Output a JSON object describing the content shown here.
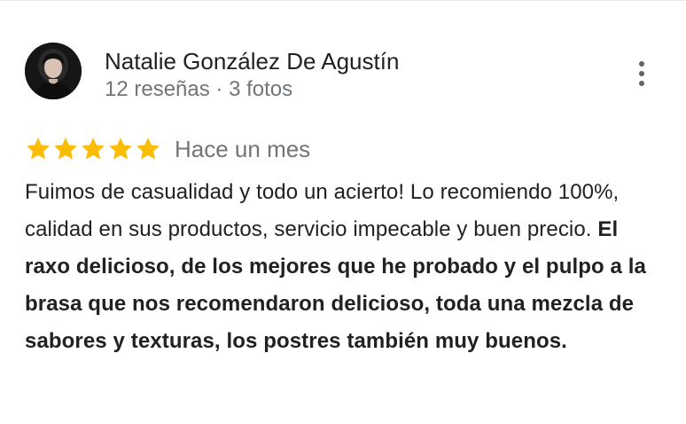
{
  "author": {
    "name": "Natalie González De Agustín",
    "meta": "12 reseñas · 3 fotos"
  },
  "review": {
    "rating": 5,
    "max_rating": 5,
    "date": "Hace un mes",
    "text_regular": "Fuimos de casualidad y todo un acierto! Lo recomiendo 100%, calidad en sus productos, servicio impecable y buen precio. ",
    "text_bold": "El raxo delicioso, de los mejores que he probado y el pulpo a la brasa que nos recomendaron delicioso, toda una mezcla de sabores y texturas, los postres también muy buenos."
  },
  "icons": {
    "star": "star-icon",
    "menu": "more-vert-icon",
    "avatar": "profile-photo"
  },
  "colors": {
    "star": "#fbbc04",
    "secondary_text": "#70757a",
    "primary_text": "#202124"
  }
}
